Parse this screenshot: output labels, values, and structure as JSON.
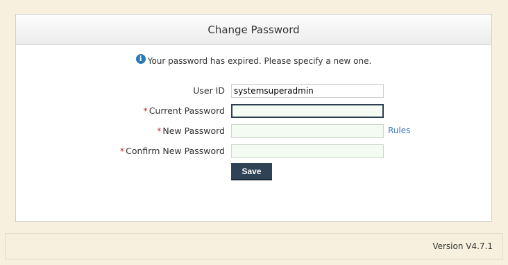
{
  "header": {
    "title": "Change Password"
  },
  "info": {
    "icon": "info-icon",
    "message": "Your password has expired. Please specify a new one."
  },
  "form": {
    "required_marker": "*",
    "user_id_label": "User ID",
    "user_id_value": "systemsuperadmin",
    "current_password_label": "Current Password",
    "current_password_value": "",
    "new_password_label": "New Password",
    "new_password_value": "",
    "confirm_password_label": "Confirm New Password",
    "confirm_password_value": "",
    "rules_link": "Rules",
    "save_label": "Save"
  },
  "footer": {
    "version": "Version V4.7.1"
  },
  "colors": {
    "accent": "#2f4356",
    "required": "#c1272d",
    "link": "#3b77c0",
    "page_bg": "#f7f0de"
  }
}
